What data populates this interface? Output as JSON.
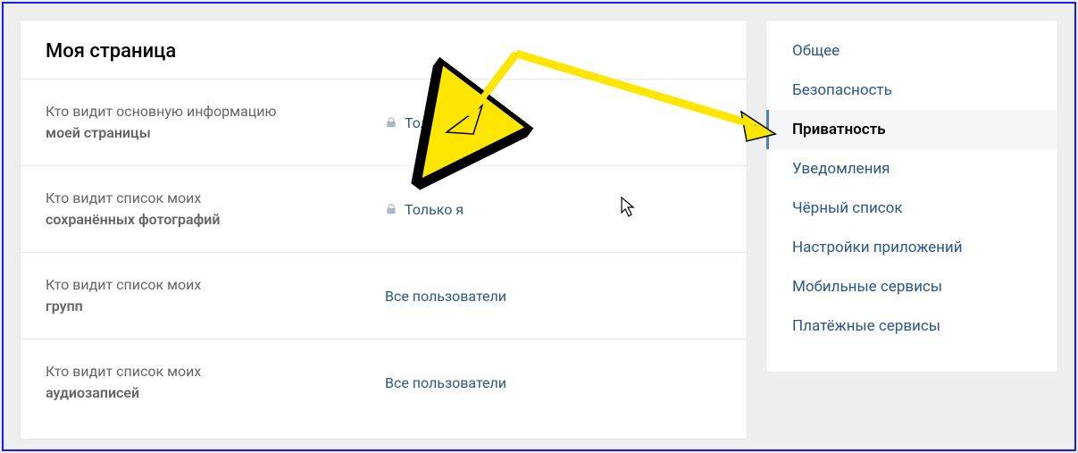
{
  "header": {
    "title": "Моя страница"
  },
  "settings": [
    {
      "label_pre": "Кто видит основную информацию ",
      "label_bold": "моей страницы",
      "value": "Только друзья",
      "locked": true
    },
    {
      "label_pre": "Кто видит список моих ",
      "label_bold": "сохранённых фотографий",
      "value": "Только я",
      "locked": true
    },
    {
      "label_pre": "Кто видит список моих ",
      "label_bold": "групп",
      "value": "Все пользователи",
      "locked": false
    },
    {
      "label_pre": "Кто видит список моих ",
      "label_bold": "аудиозаписей",
      "value": "Все пользователи",
      "locked": false
    }
  ],
  "sidebar": {
    "items": [
      {
        "label": "Общее",
        "active": false
      },
      {
        "label": "Безопасность",
        "active": false
      },
      {
        "label": "Приватность",
        "active": true
      },
      {
        "label": "Уведомления",
        "active": false
      },
      {
        "label": "Чёрный список",
        "active": false
      },
      {
        "label": "Настройки приложений",
        "active": false
      },
      {
        "label": "Мобильные сервисы",
        "active": false
      },
      {
        "label": "Платёжные сервисы",
        "active": false
      }
    ]
  }
}
